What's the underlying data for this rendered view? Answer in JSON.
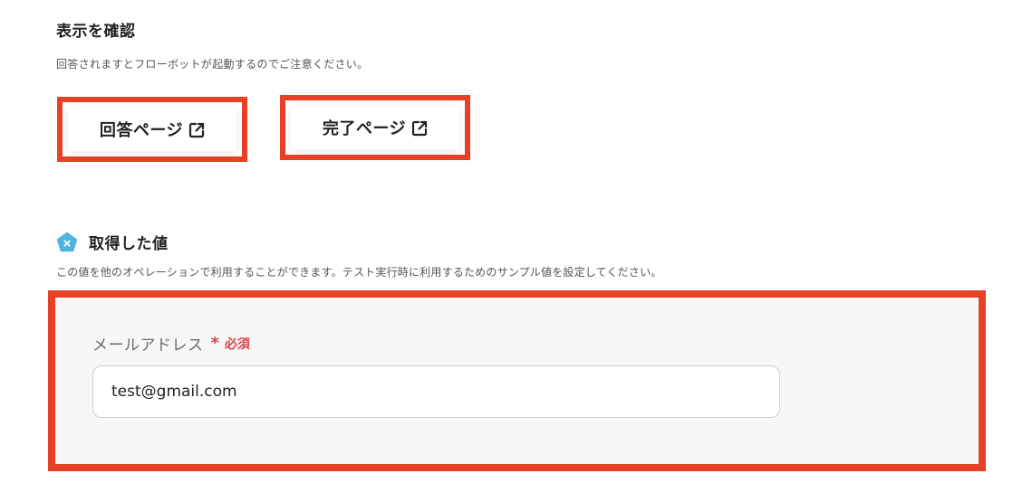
{
  "display_section": {
    "title": "表示を確認",
    "description": "回答されますとフローボットが起動するのでご注意ください。",
    "buttons": [
      {
        "label": "回答ページ",
        "icon": "external-link-icon"
      },
      {
        "label": "完了ページ",
        "icon": "external-link-icon"
      }
    ]
  },
  "acquired_section": {
    "icon": "pentagon-x-icon",
    "title": "取得した値",
    "description": "この値を他のオペレーションで利用することができます。テスト実行時に利用するためのサンプル値を設定してください。"
  },
  "form": {
    "field_label": "メールアドレス",
    "required_mark": "*",
    "required_text": "必須",
    "value": "test@gmail.com"
  },
  "colors": {
    "highlight": "#e84024",
    "required": "#e0444b",
    "icon_blue": "#4fb3e0"
  }
}
